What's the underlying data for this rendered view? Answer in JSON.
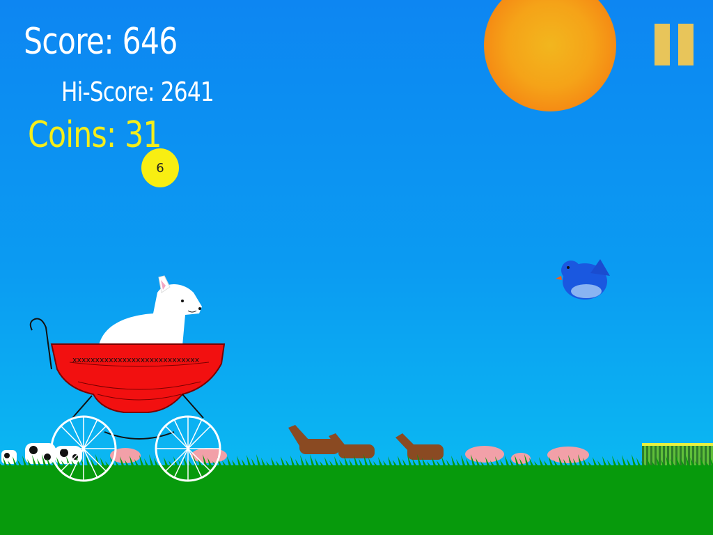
{
  "hud": {
    "score_label": "Score: 646",
    "hiscore_label": "Hi-Score: 2641",
    "coins_label": "Coins: 31"
  },
  "coin": {
    "value": "6"
  },
  "icons": {
    "pause": "pause-icon"
  },
  "colors": {
    "sky": "#0b9bf2",
    "ground": "#079a0c",
    "coins_text": "#f5ee1a",
    "pause": "#e8c55a",
    "carriage": "#f21010"
  }
}
